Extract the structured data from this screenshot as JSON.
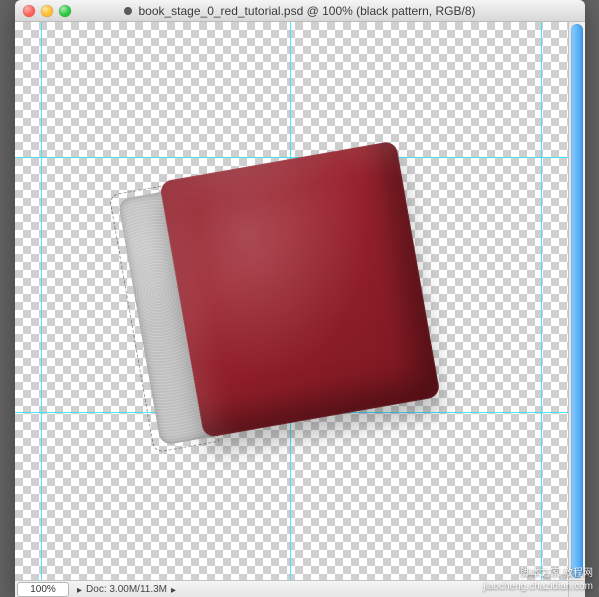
{
  "window": {
    "title": "book_stage_0_red_tutorial.psd @ 100% (black pattern, RGB/8)"
  },
  "statusbar": {
    "zoom": "100%",
    "doc_label": "Doc: 3.00M/11.3M",
    "popup_glyph": "▸"
  },
  "guides": {
    "v": [
      26,
      275,
      526
    ],
    "h": [
      135,
      390
    ]
  },
  "watermark": {
    "line1": "脚本之家 教程网",
    "line2": "jiaocheng.chazidian.com"
  }
}
